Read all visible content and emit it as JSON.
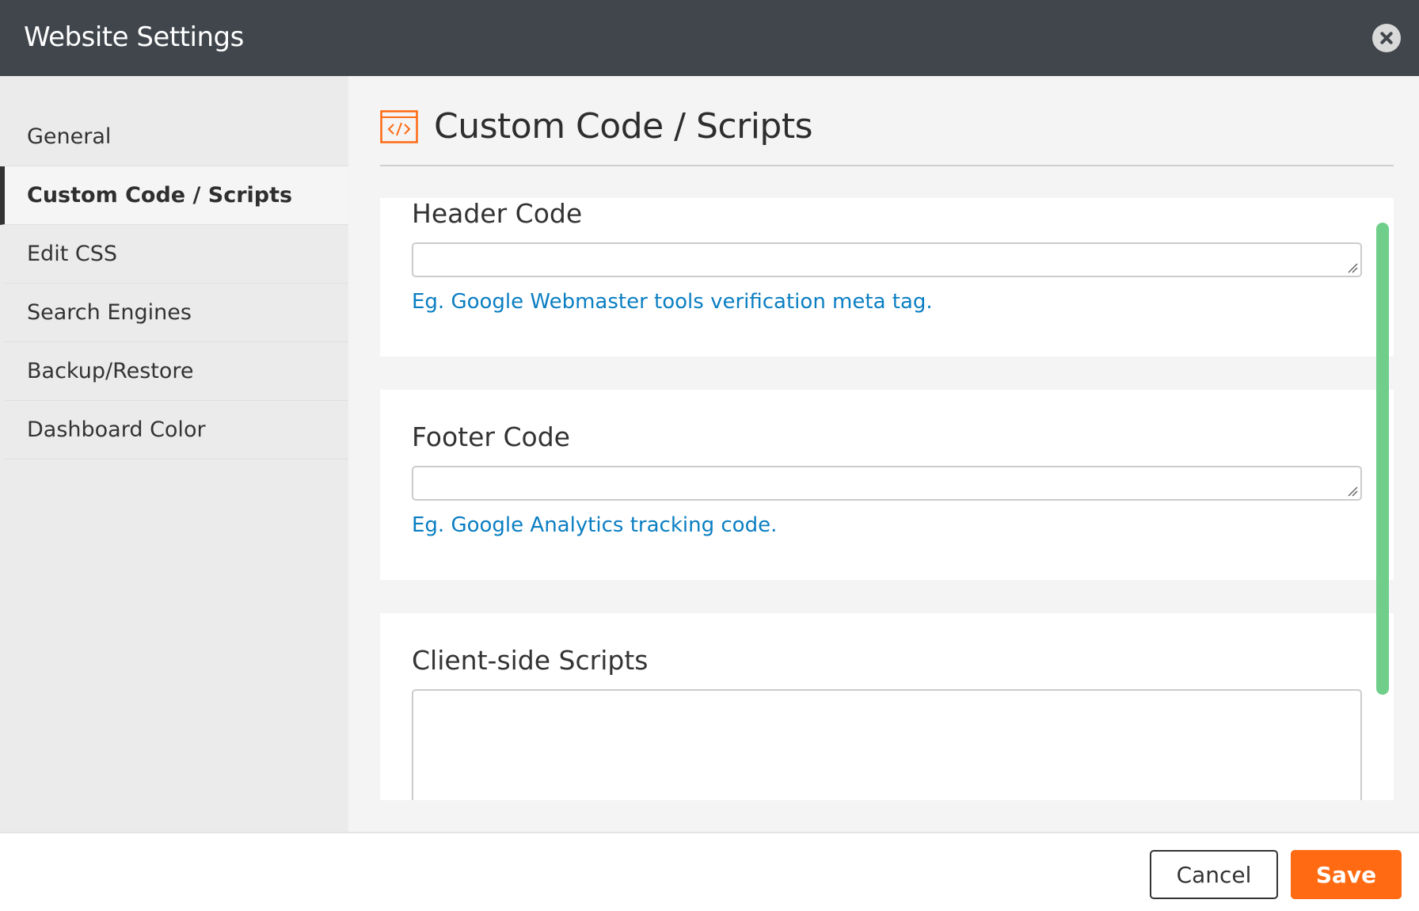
{
  "window": {
    "title": "Website Settings",
    "close_icon": "close-icon"
  },
  "sidebar": {
    "items": [
      {
        "label": "General",
        "active": false
      },
      {
        "label": "Custom Code / Scripts",
        "active": true
      },
      {
        "label": "Edit CSS",
        "active": false
      },
      {
        "label": "Search Engines",
        "active": false
      },
      {
        "label": "Backup/Restore",
        "active": false
      },
      {
        "label": "Dashboard Color",
        "active": false
      }
    ]
  },
  "main": {
    "title": "Custom Code / Scripts",
    "icon": "code-icon",
    "icon_color": "#ff6a13",
    "sections": {
      "header_code": {
        "label": "Header Code",
        "value": "",
        "hint": "Eg. Google Webmaster tools verification meta tag."
      },
      "footer_code": {
        "label": "Footer Code",
        "value": "",
        "hint": "Eg. Google Analytics tracking code."
      },
      "client_scripts": {
        "label": "Client-side Scripts",
        "value": ""
      }
    }
  },
  "footer": {
    "cancel_label": "Cancel",
    "save_label": "Save"
  },
  "colors": {
    "header_bg": "#41464d",
    "accent": "#ff6a13",
    "link": "#0a7ec2",
    "scrollbar": "#6fcf8a"
  }
}
